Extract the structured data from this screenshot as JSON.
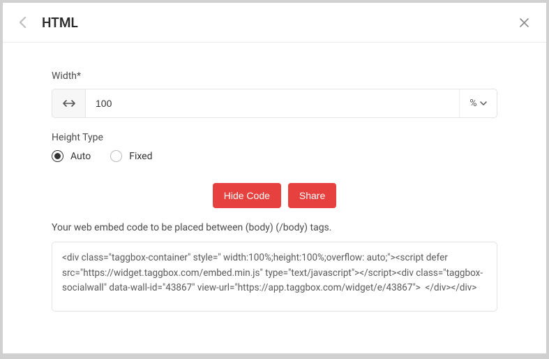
{
  "header": {
    "title": "HTML"
  },
  "form": {
    "width_label": "Width*",
    "width_value": "100",
    "unit_selected": "%",
    "height_type_label": "Height Type",
    "options": {
      "auto": "Auto",
      "fixed": "Fixed"
    }
  },
  "buttons": {
    "hide_code": "Hide Code",
    "share": "Share"
  },
  "embed": {
    "help": "Your web embed code to be placed between (body) (/body) tags.",
    "code": "<div class=\"taggbox-container\" style=\" width:100%;height:100%;overflow: auto;\"><script defer src=\"https://widget.taggbox.com/embed.min.js\" type=\"text/javascript\"></script><div class=\"taggbox-socialwall\" data-wall-id=\"43867\" view-url=\"https://app.taggbox.com/widget/e/43867\">  </div></div>"
  }
}
